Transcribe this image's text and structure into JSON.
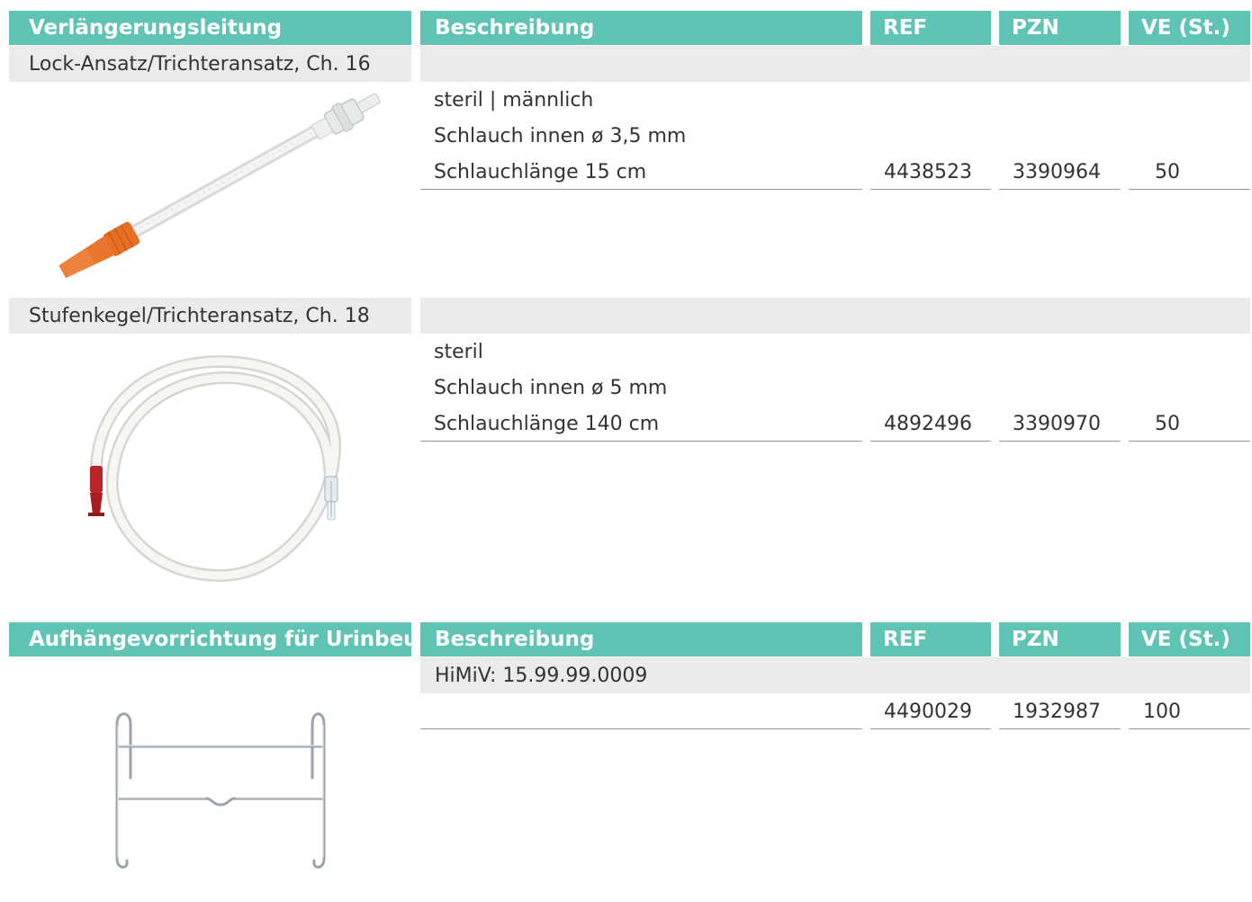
{
  "section1": {
    "header": {
      "title": "Verlängerungsleitung",
      "desc": "Beschreibung",
      "ref": "REF",
      "pzn": "PZN",
      "ve": "VE (St.)"
    },
    "products": [
      {
        "name": "Lock-Ansatz/Trichteransatz, Ch. 16",
        "lines": [
          "steril  |  männlich",
          "Schlauch innen ø 3,5 mm",
          "Schlauchlänge 15 cm"
        ],
        "ref": "4438523",
        "pzn": "3390964",
        "ve": "50",
        "image_icon": "extension-tube-short-image"
      },
      {
        "name": "Stufenkegel/Trichteransatz, Ch. 18",
        "lines": [
          "steril",
          "Schlauch innen ø 5 mm",
          "Schlauchlänge 140 cm"
        ],
        "ref": "4892496",
        "pzn": "3390970",
        "ve": "50",
        "image_icon": "extension-tube-long-image"
      }
    ]
  },
  "section2": {
    "header": {
      "title": "Aufhängevorrichtung für Urinbeutel",
      "desc": "Beschreibung",
      "ref": "REF",
      "pzn": "PZN",
      "ve": "VE (St.)"
    },
    "product": {
      "note": "HiMiV: 15.99.99.0009",
      "ref": "4490029",
      "pzn": "1932987",
      "ve": "100",
      "image_icon": "urine-bag-hanger-image"
    }
  },
  "colors": {
    "header_bg": "#5fc4b3",
    "row_bg": "#ebebeb",
    "text": "#333333"
  }
}
